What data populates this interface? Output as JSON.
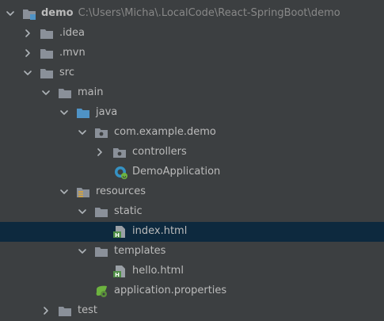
{
  "project_tree": {
    "root": {
      "name": "demo",
      "path": "C:\\Users\\Micha\\.LocalCode\\React-SpringBoot\\demo"
    },
    "items": [
      {
        "label": "demo",
        "expanded": true,
        "icon": "module-folder-icon"
      },
      {
        "label": ".idea",
        "expanded": false,
        "icon": "folder-icon"
      },
      {
        "label": ".mvn",
        "expanded": false,
        "icon": "folder-icon"
      },
      {
        "label": "src",
        "expanded": true,
        "icon": "folder-icon"
      },
      {
        "label": "main",
        "expanded": true,
        "icon": "folder-icon"
      },
      {
        "label": "java",
        "expanded": true,
        "icon": "source-root-folder-icon"
      },
      {
        "label": "com.example.demo",
        "expanded": true,
        "icon": "package-icon"
      },
      {
        "label": "controllers",
        "expanded": false,
        "icon": "package-icon"
      },
      {
        "label": "DemoApplication",
        "icon": "spring-boot-class-icon"
      },
      {
        "label": "resources",
        "expanded": true,
        "icon": "resources-folder-icon"
      },
      {
        "label": "static",
        "expanded": true,
        "icon": "folder-icon"
      },
      {
        "label": "index.html",
        "icon": "html-file-icon",
        "selected": true
      },
      {
        "label": "templates",
        "expanded": true,
        "icon": "folder-icon"
      },
      {
        "label": "hello.html",
        "icon": "html-file-icon"
      },
      {
        "label": "application.properties",
        "icon": "spring-properties-icon"
      },
      {
        "label": "test",
        "expanded": false,
        "icon": "folder-icon"
      }
    ]
  },
  "colors": {
    "background": "#3c3f41",
    "selection": "#0d293e",
    "text": "#bbbbbb",
    "path_text": "#888888",
    "folder": "#8a9099",
    "source_root": "#4f93c6",
    "html_icon": "#4e8d45",
    "spring_green": "#6db33f"
  }
}
